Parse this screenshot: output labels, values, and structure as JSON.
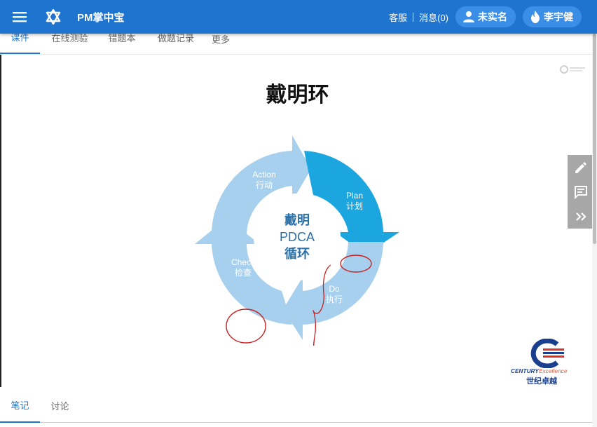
{
  "header": {
    "app_title": "PM掌中宝",
    "service_label": "客服",
    "messages_label": "消息(0)",
    "identity_label": "未实名",
    "user_name": "李宇健",
    "icons": [
      "menu-icon",
      "star-of-david-icon",
      "person-icon",
      "flame-icon"
    ],
    "colors": {
      "bar": "#1f74d0",
      "pill": "#3a8ee6"
    }
  },
  "tabs": [
    {
      "label": "课件",
      "active": true
    },
    {
      "label": "在线测验",
      "active": false
    },
    {
      "label": "错题本",
      "active": false
    },
    {
      "label": "做题记录",
      "active": false
    },
    {
      "label": "更多",
      "active": false
    }
  ],
  "slide": {
    "title": "戴明环",
    "center_text": [
      "戴明",
      "PDCA",
      "循环"
    ],
    "stages": [
      {
        "en": "Plan",
        "cn": "计划"
      },
      {
        "en": "Do",
        "cn": "执行"
      },
      {
        "en": "Check",
        "cn": "检查"
      },
      {
        "en": "Action",
        "cn": "行动"
      }
    ],
    "brand_en": "CENTURY",
    "brand_en_suffix": "Excellence",
    "brand_cn": "世纪卓越",
    "colors": {
      "arrow_light": "#a6d0ee",
      "arrow_dark": "#1ba6e0",
      "center_text": "#2a6fa8",
      "annotation": "#cc1f1f"
    }
  },
  "side_tools": [
    "pencil-icon",
    "comment-icon",
    "double-chevron-right-icon"
  ],
  "bottom_tabs": [
    {
      "label": "笔记",
      "active": true
    },
    {
      "label": "讨论",
      "active": false
    }
  ]
}
